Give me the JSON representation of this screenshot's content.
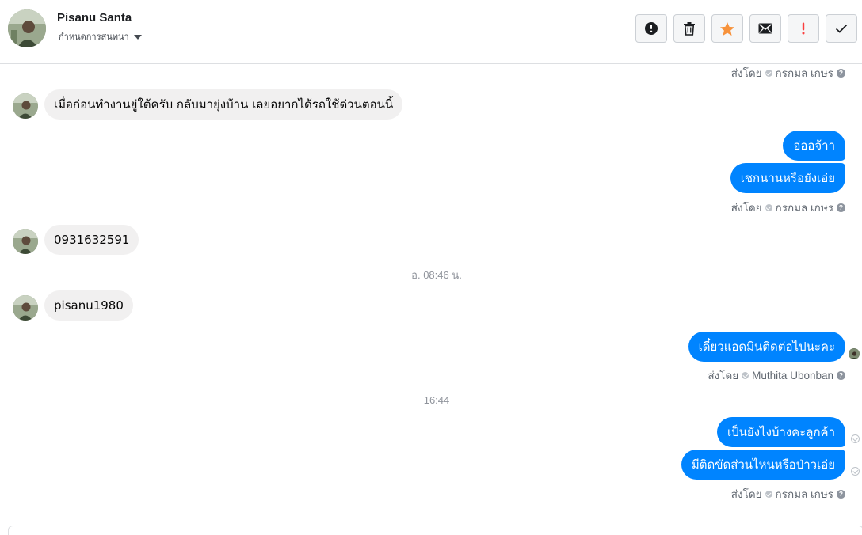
{
  "header": {
    "contact_name": "Pisanu Santa",
    "assign_label": "กำหนดการสนทนา",
    "actions": [
      {
        "name": "spam-button",
        "icon": "alert-circle-icon"
      },
      {
        "name": "delete-button",
        "icon": "trash-icon"
      },
      {
        "name": "star-button",
        "icon": "star-icon",
        "color": "#f7923b"
      },
      {
        "name": "mark-unread-button",
        "icon": "envelope-icon"
      },
      {
        "name": "follow-up-button",
        "icon": "exclamation-icon",
        "color": "#fa3e3e"
      },
      {
        "name": "mark-done-button",
        "icon": "checkmark-icon"
      }
    ]
  },
  "thread": {
    "sent_by_prefix": "ส่งโดย",
    "meta_top": {
      "sender": "กรกมล เกษร"
    },
    "msg_in_1": "เมื่อก่อนทำงานยู่ใต้ครับ  กลับมายุ่งบ้าน  เลยอยากได้รถใช้ด่วนตอนนี้",
    "msg_out_1": "อ่ออจ้าา",
    "msg_out_2": "เชกนานหรือยังเอ่ย",
    "meta_1": {
      "sender": "กรกมล เกษร"
    },
    "msg_in_2": "0931632591",
    "timestamp_1": "อ. 08:46 น.",
    "msg_in_3": "pisanu1980",
    "msg_out_3": "เดี๋ยวแอดมินติดต่อไปนะคะ",
    "meta_2": {
      "sender": "Muthita Ubonban"
    },
    "timestamp_2": "16:44",
    "msg_out_4": "เป็นยังไงบ้างคะลูกค้า",
    "msg_out_5": "มีติดขัดส่วนไหนหรือป่าวเอ่ย",
    "meta_3": {
      "sender": "กรกมล เกษร"
    },
    "help_glyph": "?"
  },
  "colors": {
    "outgoing_bubble": "#0084ff",
    "incoming_bubble": "#f1f0f0"
  }
}
